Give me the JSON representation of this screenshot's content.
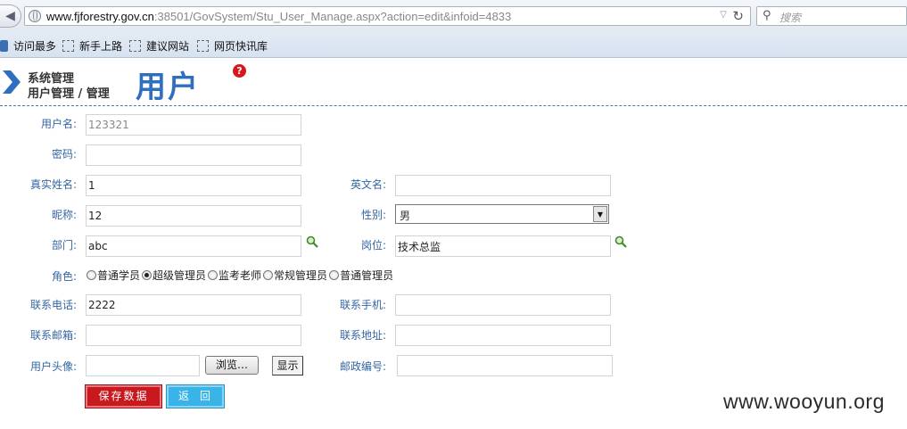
{
  "browser": {
    "url_domain": "www.fjforestry.gov.cn",
    "url_rest": ":38501/GovSystem/Stu_User_Manage.aspx?action=edit&infoid=4833",
    "search_placeholder": "搜索",
    "bookmarks": [
      "访问最多",
      "新手上路",
      "建议网站",
      "网页快讯库"
    ]
  },
  "header": {
    "breadcrumb_top": "系统管理",
    "breadcrumb_bottom": "用户管理 / 管理",
    "title": "用户",
    "help": "?"
  },
  "form": {
    "username": {
      "label": "用户名:",
      "value": "123321"
    },
    "password": {
      "label": "密码:",
      "value": ""
    },
    "realname": {
      "label": "真实姓名:",
      "value": "1"
    },
    "englishname": {
      "label": "英文名:",
      "value": ""
    },
    "nickname": {
      "label": "昵称:",
      "value": "12"
    },
    "gender": {
      "label": "性别:",
      "value": "男"
    },
    "department": {
      "label": "部门:",
      "value": "abc"
    },
    "position": {
      "label": "岗位:",
      "value": "技术总监"
    },
    "role": {
      "label": "角色:",
      "options": [
        "普通学员",
        "超级管理员",
        "监考老师",
        "常规管理员",
        "普通管理员"
      ],
      "selected": "超级管理员"
    },
    "phone": {
      "label": "联系电话:",
      "value": "2222"
    },
    "mobile": {
      "label": "联系手机:",
      "value": ""
    },
    "email": {
      "label": "联系邮箱:",
      "value": ""
    },
    "address": {
      "label": "联系地址:",
      "value": ""
    },
    "avatar": {
      "label": "用户头像:",
      "value": "",
      "browse_label": "浏览…",
      "show_label": "显示"
    },
    "postcode": {
      "label": "邮政编号:",
      "value": ""
    }
  },
  "actions": {
    "save_label": "保存数据",
    "back_label": "返回"
  },
  "watermark": "www.wooyun.org"
}
